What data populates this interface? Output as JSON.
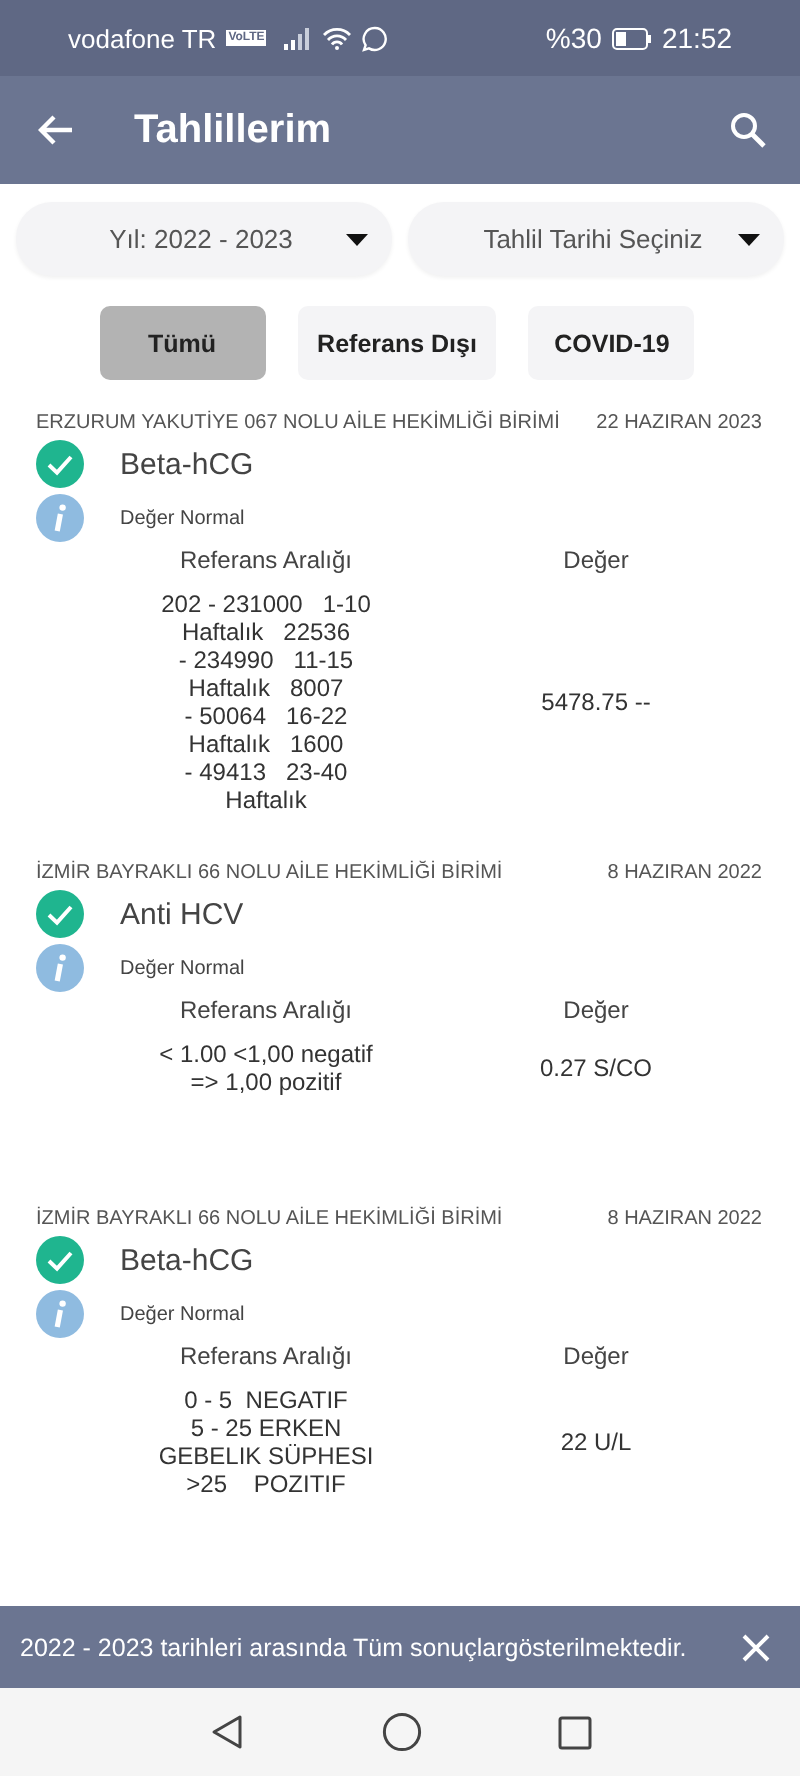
{
  "status_bar": {
    "carrier": "vodafone TR",
    "network_badge": "VoLTE",
    "battery": "%30",
    "time": "21:52"
  },
  "app_bar": {
    "title": "Tahlillerim"
  },
  "filters": [
    {
      "label": "Yıl: 2022 - 2023"
    },
    {
      "label": "Tahlil Tarihi Seçiniz"
    }
  ],
  "chips": [
    {
      "label": "Tümü",
      "selected": true
    },
    {
      "label": "Referans Dışı",
      "selected": false
    },
    {
      "label": "COVID-19",
      "selected": false
    }
  ],
  "results": [
    {
      "facility": "ERZURUM YAKUTİYE 067 NOLU AİLE HEKİMLİĞİ BİRİMİ",
      "date": "22 HAZIRAN 2023",
      "test": "Beta-hCG",
      "normal": true,
      "note": "Değer Normal",
      "ref_header": "Referans Aralığı",
      "value_header": "Değer",
      "reference": [
        "202 - 231000   1-10",
        "Haftalık   22536",
        "- 234990   11-15",
        "Haftalık   8007",
        "- 50064   16-22",
        "Haftalık   1600",
        "- 49413   23-40",
        "Haftalık"
      ],
      "value": "5478.75 --"
    },
    {
      "facility": "İZMİR BAYRAKLI 66 NOLU AİLE HEKİMLİĞİ BİRİMİ",
      "date": "8 HAZIRAN 2022",
      "test": "Anti HCV",
      "normal": true,
      "note": "Değer Normal",
      "ref_header": "Referans Aralığı",
      "value_header": "Değer",
      "reference": [
        "< 1.00 <1,00 negatif",
        "=> 1,00 pozitif"
      ],
      "value": "0.27 S/CO"
    },
    {
      "facility": "İZMİR BAYRAKLI 66 NOLU AİLE HEKİMLİĞİ BİRİMİ",
      "date": "8 HAZIRAN 2022",
      "test": "Beta-hCG",
      "normal": true,
      "note": "Değer Normal",
      "ref_header": "Referans Aralığı",
      "value_header": "Değer",
      "reference": [
        "0 - 5  NEGATIF",
        "5 - 25 ERKEN",
        "GEBELIK SÜPHESI",
        ">25    POZITIF"
      ],
      "value": "22 U/L"
    }
  ],
  "banner": {
    "message": "2022 - 2023 tarihleri arasında Tüm sonuçlargösterilmektedir."
  }
}
